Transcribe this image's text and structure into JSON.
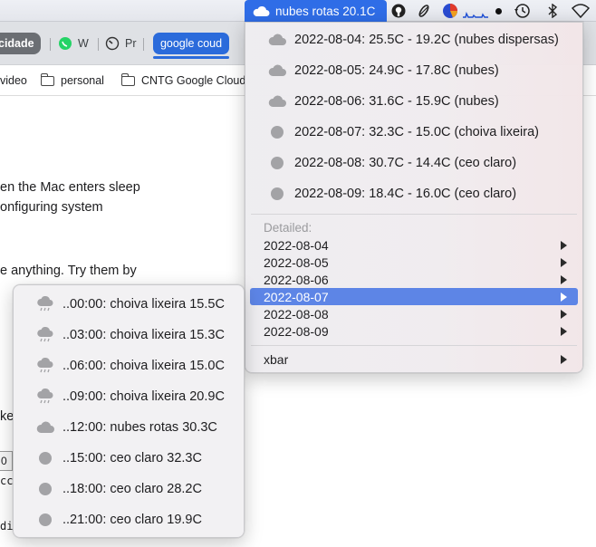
{
  "menubar": {
    "weather_label": "nubes rotas 20.1C",
    "icons": [
      "cloud-icon",
      "github-icon",
      "hotdog-icon",
      "pie-chart-icon",
      "activity-graph-icon",
      "dot-icon",
      "time-machine-icon",
      "bluetooth-icon",
      "wifi-icon"
    ]
  },
  "browser": {
    "tabs": [
      {
        "label": "cidade",
        "state": "group"
      },
      {
        "label": "W",
        "icon": "whatsapp-icon"
      },
      {
        "label": "Pr",
        "icon": "speedometer-icon"
      },
      {
        "label": "google coud",
        "state": "group-active"
      }
    ],
    "bookmarks": [
      "video",
      "personal",
      "CNTG Google Cloud"
    ]
  },
  "page": {
    "lines": [
      "en the Mac enters sleep",
      "onfiguring system",
      "e anything. Try them by",
      "ke",
      "0",
      "cc",
      "di"
    ]
  },
  "main_menu": {
    "forecast": [
      {
        "text": "2022-08-04: 25.5C - 19.2C (nubes dispersas)",
        "icon": "cloud-icon"
      },
      {
        "text": "2022-08-05: 24.9C - 17.8C (nubes)",
        "icon": "cloud-icon"
      },
      {
        "text": "2022-08-06: 31.6C - 15.9C (nubes)",
        "icon": "cloud-icon"
      },
      {
        "text": "2022-08-07: 32.3C - 15.0C (choiva lixeira)",
        "icon": "circle-icon"
      },
      {
        "text": "2022-08-08: 30.7C - 14.4C (ceo claro)",
        "icon": "circle-icon"
      },
      {
        "text": "2022-08-09: 18.4C - 16.0C (ceo claro)",
        "icon": "circle-icon"
      }
    ],
    "detailed_label": "Detailed:",
    "detailed": [
      "2022-08-04",
      "2022-08-05",
      "2022-08-06",
      "2022-08-07",
      "2022-08-08",
      "2022-08-09"
    ],
    "selected_detail": "2022-08-07",
    "xbar_label": "xbar"
  },
  "detail_menu": {
    "items": [
      {
        "text": "..00:00: choiva lixeira 15.5C",
        "icon": "rain-cloud-icon"
      },
      {
        "text": "..03:00: choiva lixeira 15.3C",
        "icon": "rain-cloud-icon"
      },
      {
        "text": "..06:00: choiva lixeira 15.0C",
        "icon": "rain-cloud-icon"
      },
      {
        "text": "..09:00: choiva lixeira 20.9C",
        "icon": "rain-cloud-icon"
      },
      {
        "text": "..12:00: nubes rotas 30.3C",
        "icon": "cloud-icon"
      },
      {
        "text": "..15:00: ceo claro 32.3C",
        "icon": "circle-icon"
      },
      {
        "text": "..18:00: ceo claro 28.2C",
        "icon": "circle-icon"
      },
      {
        "text": "..21:00: ceo claro 19.9C",
        "icon": "circle-icon"
      }
    ]
  },
  "colors": {
    "accent": "#2f6de7",
    "menu_highlight": "#5d85e6",
    "icon_gray": "#a3a3a6"
  }
}
